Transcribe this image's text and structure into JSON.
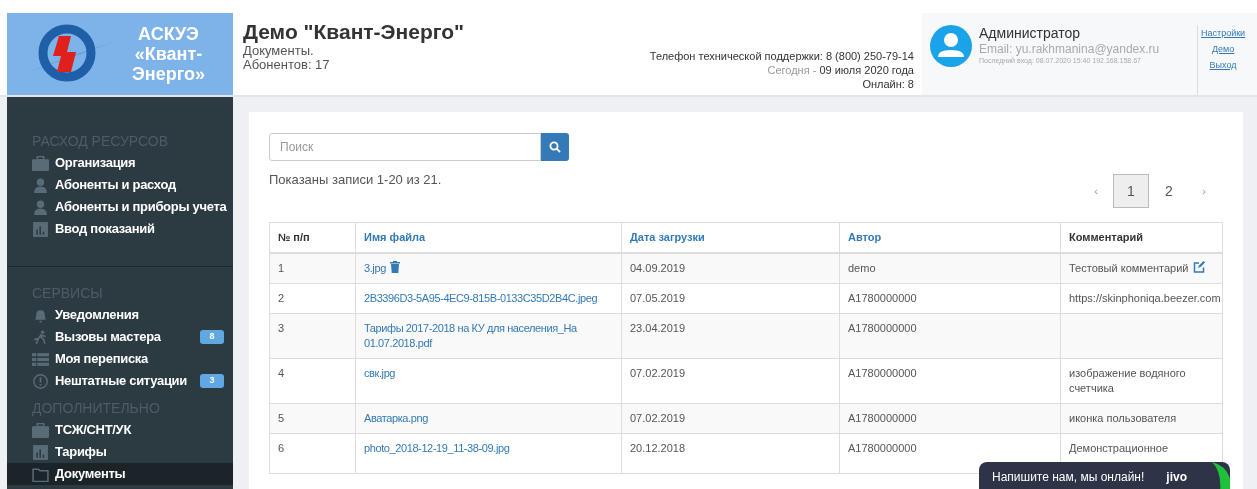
{
  "logo": {
    "title_lines": [
      "АСКУЭ",
      "«Квант-",
      "Энерго»"
    ]
  },
  "header": {
    "title": "Демо \"Квант-Энерго\"",
    "subtitle": "Документы.",
    "subscribers": "Абонентов: 17",
    "support": "Телефон технической поддержки: 8 (800) 250-79-14",
    "today_label": "Сегодня - ",
    "today_value": "09 июля 2020 года",
    "online": "Онлайн: 8"
  },
  "user": {
    "name": "Администратор",
    "email": "Email: yu.rakhmanina@yandex.ru",
    "last_login": "Последний вход: 08.07.2020 15:40 192.168.158.67",
    "links": [
      "Настройки",
      "Демо",
      "Выход"
    ]
  },
  "sidebar": {
    "sections": [
      {
        "title": "РАСХОД РЕСУРСОВ",
        "items": [
          {
            "label": "Организация",
            "kind": "briefcase",
            "selected": false
          },
          {
            "label": "Абоненты и расход",
            "kind": "user",
            "selected": false
          },
          {
            "label": "Абоненты и приборы учета",
            "kind": "user",
            "selected": false
          },
          {
            "label": "Ввод показаний",
            "kind": "chart",
            "selected": false
          }
        ]
      },
      {
        "title": "СЕРВИСЫ",
        "items": [
          {
            "label": "Уведомления",
            "kind": "bell",
            "selected": false
          },
          {
            "label": "Вызовы мастера",
            "kind": "runner",
            "selected": false,
            "badge": "8"
          },
          {
            "label": "Моя переписка",
            "kind": "list",
            "selected": false
          },
          {
            "label": "Нештатные ситуации",
            "kind": "alert",
            "selected": false,
            "badge": "3"
          }
        ]
      },
      {
        "title": "ДОПОЛНИТЕЛЬНО",
        "items": [
          {
            "label": "ТСЖ/СНТ/УК",
            "kind": "briefcase",
            "selected": false
          },
          {
            "label": "Тарифы",
            "kind": "chart",
            "selected": false
          },
          {
            "label": "Документы",
            "kind": "folder",
            "selected": true
          }
        ]
      }
    ]
  },
  "search": {
    "placeholder": "Поиск"
  },
  "summary": "Показаны записи 1-20 из 21.",
  "pagination": {
    "prev": "‹",
    "pages": [
      {
        "label": "1",
        "selected": true
      },
      {
        "label": "2",
        "selected": false
      }
    ],
    "next": "›"
  },
  "table": {
    "columns": [
      {
        "label": "№ п/п",
        "sortable": false
      },
      {
        "label": "Имя файла",
        "sortable": true
      },
      {
        "label": "Дата загрузки",
        "sortable": true
      },
      {
        "label": "Автор",
        "sortable": true
      },
      {
        "label": "Комментарий",
        "sortable": false
      }
    ],
    "rows": [
      {
        "n": "1",
        "file": "3.jpg",
        "deletable": true,
        "date": "04.09.2019",
        "author": "demo",
        "comment": "Тестовый комментарий",
        "editable": true
      },
      {
        "n": "2",
        "file": "2B3396D3-5A95-4EC9-815B-0133C35D2B4C.jpeg",
        "date": "07.05.2019",
        "author": "A1780000000",
        "comment": "https://skinphoniqa.beezer.com"
      },
      {
        "n": "3",
        "file": "Тарифы 2017-2018 на КУ для населения_На 01.07.2018.pdf",
        "date": "23.04.2019",
        "author": "A1780000000"
      },
      {
        "n": "4",
        "file": "свк.jpg",
        "date": "07.02.2019",
        "author": "A1780000000",
        "comment": "изображение водяного счетчика"
      },
      {
        "n": "5",
        "file": "Аватарка.png",
        "date": "07.02.2019",
        "author": "A1780000000",
        "comment": "иконка пользователя"
      },
      {
        "n": "6",
        "file": "photo_2018-12-19_11-38-09.jpg",
        "date": "20.12.2018",
        "author": "A1780000000",
        "comment": "Демонстрационное"
      }
    ]
  },
  "chat": {
    "text": "Напишите нам, мы онлайн!",
    "brand": "jivo"
  }
}
